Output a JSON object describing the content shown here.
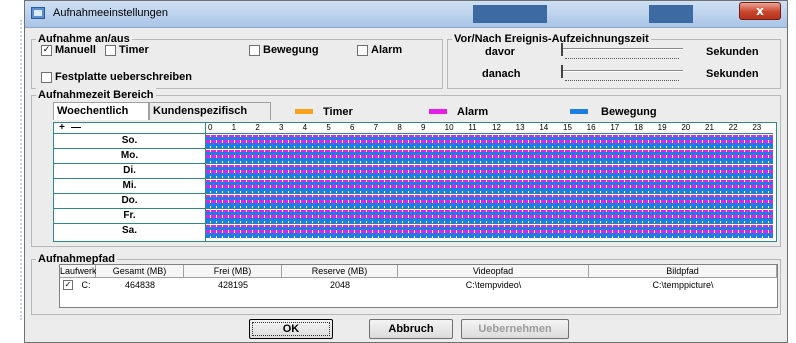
{
  "window": {
    "title": "Aufnahmeeinstellungen",
    "close_label": "x"
  },
  "aufnahme": {
    "group_label": "Aufnahme an/aus",
    "manuell_label": "Manuell",
    "manuell_checked": true,
    "timer_label": "Timer",
    "timer_checked": false,
    "bewegung_label": "Bewegung",
    "bewegung_checked": false,
    "alarm_label": "Alarm",
    "alarm_checked": false,
    "festplatte_label": "Festplatte ueberschreiben",
    "festplatte_checked": false
  },
  "ereignis": {
    "group_label": "Vor/Nach Ereignis-Aufzeichnungszeit",
    "davor_label": "davor",
    "danach_label": "danach",
    "unit_label": "Sekunden"
  },
  "bereich": {
    "group_label": "Aufnahmezeit Bereich",
    "tabs": [
      "Woechentlich",
      "Kundenspezifisch"
    ],
    "legend": [
      {
        "label": "Timer",
        "color": "#f7a21a"
      },
      {
        "label": "Alarm",
        "color": "#e61ee6"
      },
      {
        "label": "Bewegung",
        "color": "#1a7fe0"
      }
    ],
    "toolbar": {
      "add": "+",
      "remove": "—"
    },
    "hours": [
      "0",
      "1",
      "2",
      "3",
      "4",
      "5",
      "6",
      "7",
      "8",
      "9",
      "10",
      "11",
      "12",
      "13",
      "14",
      "15",
      "16",
      "17",
      "18",
      "19",
      "20",
      "21",
      "22",
      "23"
    ],
    "days": [
      "So.",
      "Mo.",
      "Di.",
      "Mi.",
      "Do.",
      "Fr.",
      "Sa."
    ]
  },
  "pfad": {
    "group_label": "Aufnahmepfad",
    "columns": [
      "Laufwerk",
      "Gesamt (MB)",
      "Frei (MB)",
      "Reserve (MB)",
      "Videopfad",
      "Bildpfad"
    ],
    "row": {
      "checked": true,
      "laufwerk": "C:",
      "gesamt": "464838",
      "frei": "428195",
      "reserve": "2048",
      "videopfad": "C:\\tempvideo\\",
      "bildpfad": "C:\\temppicture\\"
    }
  },
  "buttons": {
    "ok": "OK",
    "abbruch": "Abbruch",
    "uebernehmen": "Uebernehmen"
  }
}
